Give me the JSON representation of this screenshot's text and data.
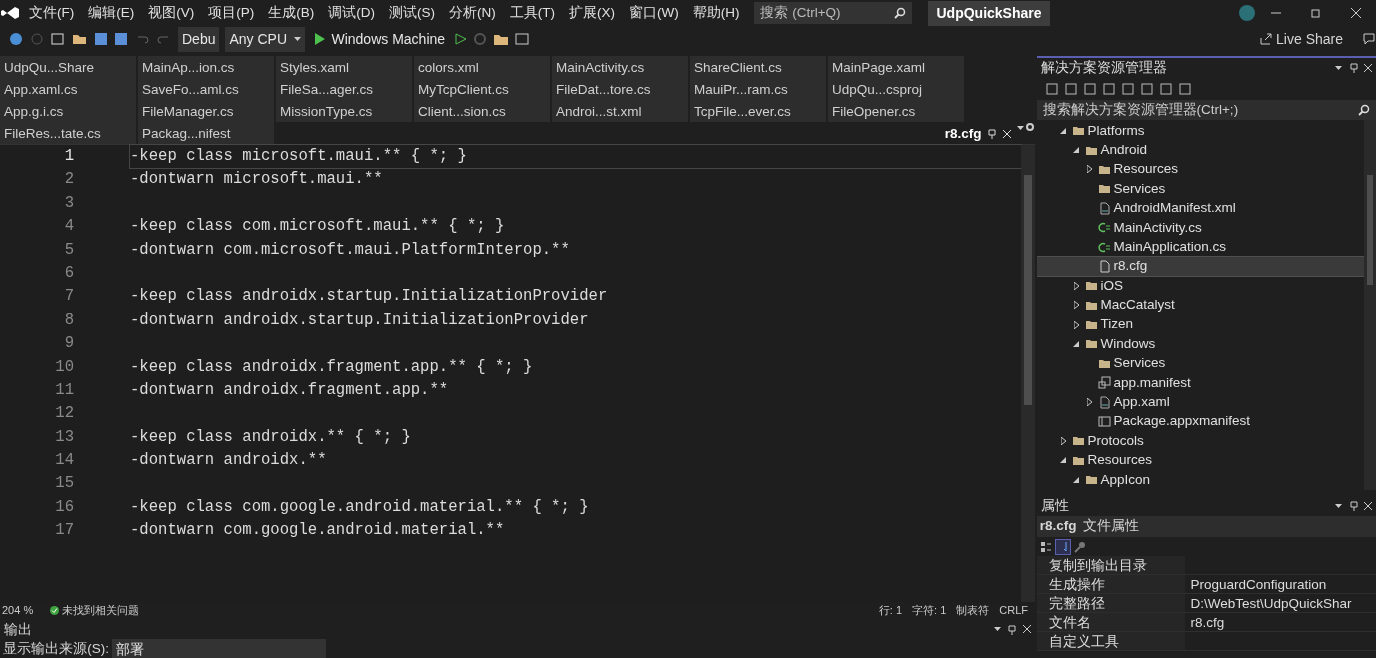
{
  "menu": [
    "文件(F)",
    "编辑(E)",
    "视图(V)",
    "项目(P)",
    "生成(B)",
    "调试(D)",
    "测试(S)",
    "分析(N)",
    "工具(T)",
    "扩展(X)",
    "窗口(W)",
    "帮助(H)"
  ],
  "search": {
    "placeholder": "搜索 (Ctrl+Q)"
  },
  "solution_name": "UdpQuickShare",
  "live_share": "Live Share",
  "toolbar": {
    "configuration": "Debu",
    "platform": "Any CPU",
    "run_target": "Windows Machine"
  },
  "doc_tabs": [
    [
      {
        "label": "UdpQu...Share",
        "selected": false
      },
      {
        "label": "MainAp...ion.cs",
        "selected": false
      },
      {
        "label": "Styles.xaml",
        "selected": false
      },
      {
        "label": "colors.xml",
        "selected": false
      },
      {
        "label": "MainActivity.cs",
        "selected": false
      },
      {
        "label": "ShareClient.cs",
        "selected": false
      },
      {
        "label": "MainPage.xaml",
        "selected": false
      }
    ],
    [
      {
        "label": "App.xaml.cs",
        "selected": false
      },
      {
        "label": "SaveFo...aml.cs",
        "selected": false
      },
      {
        "label": "FileSa...ager.cs",
        "selected": false
      },
      {
        "label": "MyTcpClient.cs",
        "selected": false
      },
      {
        "label": "FileDat...tore.cs",
        "selected": false
      },
      {
        "label": "MauiPr...ram.cs",
        "selected": false
      },
      {
        "label": "UdpQu...csproj",
        "selected": false
      }
    ],
    [
      {
        "label": "App.g.i.cs",
        "selected": false
      },
      {
        "label": "FileManager.cs",
        "selected": false
      },
      {
        "label": "MissionType.cs",
        "selected": false
      },
      {
        "label": "Client...sion.cs",
        "selected": false
      },
      {
        "label": "Androi...st.xml",
        "selected": false
      },
      {
        "label": "TcpFile...ever.cs",
        "selected": false
      },
      {
        "label": "FileOpener.cs",
        "selected": false
      }
    ],
    [
      {
        "label": "FileRes...tate.cs",
        "selected": false
      },
      {
        "label": "Packag...nifest",
        "selected": false
      },
      {
        "label": "r8.cfg",
        "selected": true
      }
    ]
  ],
  "editor": {
    "lines": [
      {
        "number": "1",
        "text": "-keep class microsoft.maui.** { *; }",
        "current": true
      },
      {
        "number": "2",
        "text": "-dontwarn microsoft.maui.**",
        "current": false
      },
      {
        "number": "3",
        "current": false
      },
      {
        "number": "4",
        "text": "-keep class com.microsoft.maui.** { *; }",
        "current": false
      },
      {
        "number": "5",
        "text": "-dontwarn com.microsoft.maui.PlatformInterop.**",
        "current": false
      },
      {
        "number": "6",
        "current": false
      },
      {
        "number": "7",
        "text": "-keep class androidx.startup.InitializationProvider",
        "current": false
      },
      {
        "number": "8",
        "text": "-dontwarn androidx.startup.InitializationProvider",
        "current": false
      },
      {
        "number": "9",
        "current": false
      },
      {
        "number": "10",
        "text": "-keep class androidx.fragment.app.** { *; }",
        "current": false
      },
      {
        "number": "11",
        "text": "-dontwarn androidx.fragment.app.**",
        "current": false
      },
      {
        "number": "12",
        "current": false
      },
      {
        "number": "13",
        "text": "-keep class androidx.** { *; }",
        "current": false
      },
      {
        "number": "14",
        "text": "-dontwarn androidx.**",
        "current": false
      },
      {
        "number": "15",
        "current": false
      },
      {
        "number": "16",
        "text": "-keep class com.google.android.material.** { *; }",
        "current": false
      },
      {
        "number": "17",
        "text": "-dontwarn com.google.android.material.**",
        "current": false
      }
    ]
  },
  "status": {
    "zoom": "204 %",
    "issues": "未找到相关问题",
    "line": "行: 1",
    "column": "字符: 1",
    "indent": "制表符",
    "line_ending": "CRLF"
  },
  "output": {
    "title": "输出",
    "source_label": "显示输出来源(S):",
    "source": "部署"
  },
  "solution_explorer": {
    "title": "解决方案资源管理器",
    "search_placeholder": "搜索解决方案资源管理器(Ctrl+;)",
    "tree": [
      {
        "label": "Platforms",
        "kind": "folder",
        "expanded": true,
        "selected": false,
        "children": [
          {
            "label": "Android",
            "kind": "folder",
            "expanded": true,
            "selected": false,
            "children": [
              {
                "label": "Resources",
                "kind": "folder",
                "expanded": false,
                "selected": false
              },
              {
                "label": "Services",
                "kind": "folder",
                "selected": false
              },
              {
                "label": "AndroidManifest.xml",
                "kind": "xml",
                "selected": false
              },
              {
                "label": "MainActivity.cs",
                "kind": "csharp",
                "selected": false
              },
              {
                "label": "MainApplication.cs",
                "kind": "csharp",
                "selected": false
              },
              {
                "label": "r8.cfg",
                "kind": "file",
                "selected": true
              }
            ]
          },
          {
            "label": "iOS",
            "kind": "folder",
            "expanded": false,
            "selected": false
          },
          {
            "label": "MacCatalyst",
            "kind": "folder",
            "expanded": false,
            "selected": false
          },
          {
            "label": "Tizen",
            "kind": "folder",
            "expanded": false,
            "selected": false
          },
          {
            "label": "Windows",
            "kind": "folder",
            "expanded": true,
            "selected": false,
            "children": [
              {
                "label": "Services",
                "kind": "folder",
                "selected": false
              },
              {
                "label": "app.manifest",
                "kind": "manifest",
                "selected": false
              },
              {
                "label": "App.xaml",
                "kind": "xml",
                "expanded": false,
                "selected": false
              },
              {
                "label": "Package.appxmanifest",
                "kind": "package",
                "selected": false
              }
            ]
          }
        ]
      },
      {
        "label": "Protocols",
        "kind": "folder",
        "expanded": false,
        "selected": false
      },
      {
        "label": "Resources",
        "kind": "folder",
        "expanded": true,
        "selected": false,
        "children": [
          {
            "label": "AppIcon",
            "kind": "folder",
            "expanded": true,
            "selected": false
          }
        ]
      }
    ]
  },
  "properties": {
    "title": "属性",
    "object_name": "r8.cfg",
    "object_type": "文件属性",
    "rows": [
      {
        "name": "复制到输出目录"
      },
      {
        "name": "生成操作",
        "value": "ProguardConfiguration"
      },
      {
        "name": "完整路径",
        "value": "D:\\WebTest\\UdpQuickShar"
      },
      {
        "name": "文件名",
        "value": "r8.cfg"
      },
      {
        "name": "自定义工具"
      }
    ]
  }
}
